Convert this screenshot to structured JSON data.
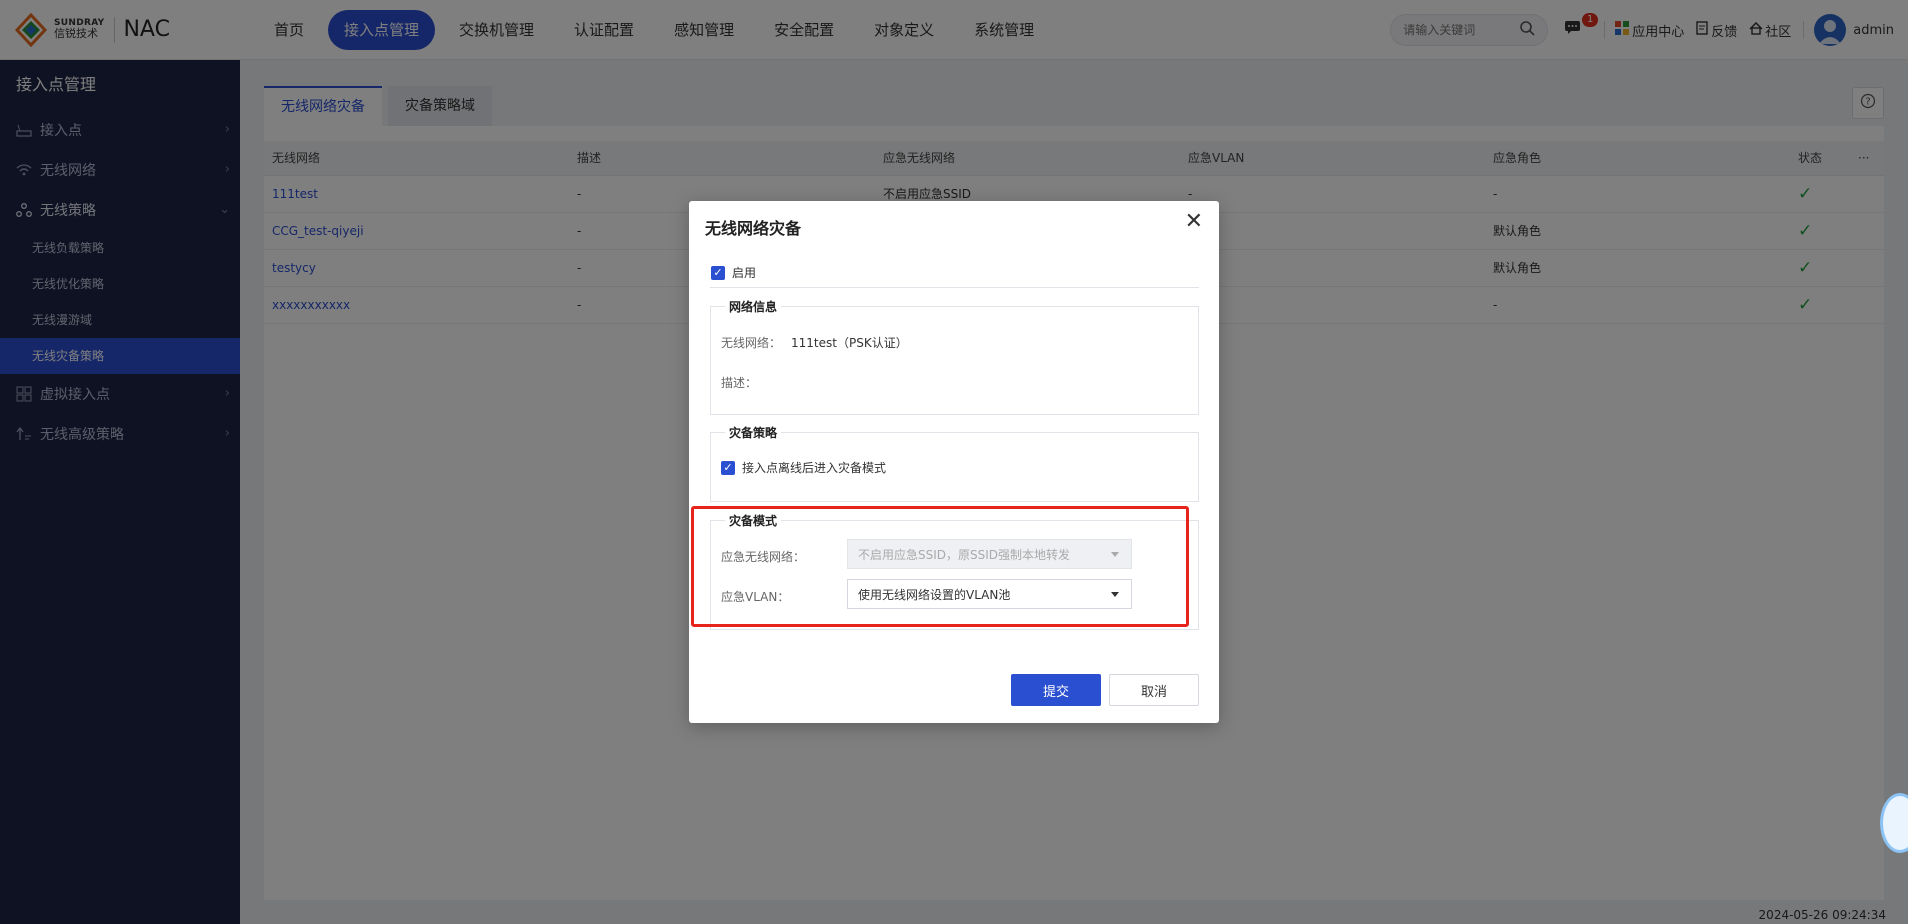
{
  "brand": {
    "en": "SUNDRAY",
    "cn": "信锐技术",
    "product": "NAC"
  },
  "nav": [
    {
      "label": "首页",
      "active": false
    },
    {
      "label": "接入点管理",
      "active": true
    },
    {
      "label": "交换机管理",
      "active": false
    },
    {
      "label": "认证配置",
      "active": false
    },
    {
      "label": "感知管理",
      "active": false
    },
    {
      "label": "安全配置",
      "active": false
    },
    {
      "label": "对象定义",
      "active": false
    },
    {
      "label": "系统管理",
      "active": false
    }
  ],
  "top_right": {
    "search_placeholder": "请输入关键词",
    "message_badge": "1",
    "app_center": "应用中心",
    "feedback": "反馈",
    "community": "社区",
    "user": "admin"
  },
  "sidebar": {
    "title": "接入点管理",
    "items": [
      {
        "label": "接入点"
      },
      {
        "label": "无线网络"
      },
      {
        "label": "无线策略"
      },
      {
        "label": "无线负载策略"
      },
      {
        "label": "无线优化策略"
      },
      {
        "label": "无线漫游域"
      },
      {
        "label": "无线灾备策略"
      },
      {
        "label": "虚拟接入点"
      },
      {
        "label": "无线高级策略"
      }
    ]
  },
  "main": {
    "tabs": [
      {
        "label": "无线网络灾备"
      },
      {
        "label": "灾备策略域"
      }
    ],
    "columns": [
      "无线网络",
      "描述",
      "应急无线网络",
      "应急VLAN",
      "应急角色",
      "状态",
      "···"
    ],
    "rows": [
      {
        "network": "111test",
        "desc": "-",
        "emergency_ssid": "不启用应急SSID",
        "vlan": "-",
        "role": "-"
      },
      {
        "network": "CCG_test-qiyeji",
        "desc": "-",
        "emergency_ssid": "",
        "vlan": "",
        "role": "默认角色"
      },
      {
        "network": "testycy",
        "desc": "-",
        "emergency_ssid": "",
        "vlan": "",
        "role": "默认角色"
      },
      {
        "network": "xxxxxxxxxxx",
        "desc": "-",
        "emergency_ssid": "",
        "vlan": "",
        "role": "-"
      }
    ],
    "timestamp": "2024-05-26 09:24:34"
  },
  "dialog": {
    "title": "无线网络灾备",
    "enable_label": "启用",
    "network_info": {
      "legend": "网络信息",
      "network_label": "无线网络：",
      "network_value": "111test（PSK认证）",
      "desc_label": "描述："
    },
    "strategy": {
      "legend": "灾备策略",
      "option_label": "接入点离线后进入灾备模式"
    },
    "mode": {
      "legend": "灾备模式",
      "ssid_label": "应急无线网络：",
      "ssid_value": "不启用应急SSID，原SSID强制本地转发",
      "vlan_label": "应急VLAN：",
      "vlan_value": "使用无线网络设置的VLAN池"
    },
    "submit": "提交",
    "cancel": "取消"
  }
}
